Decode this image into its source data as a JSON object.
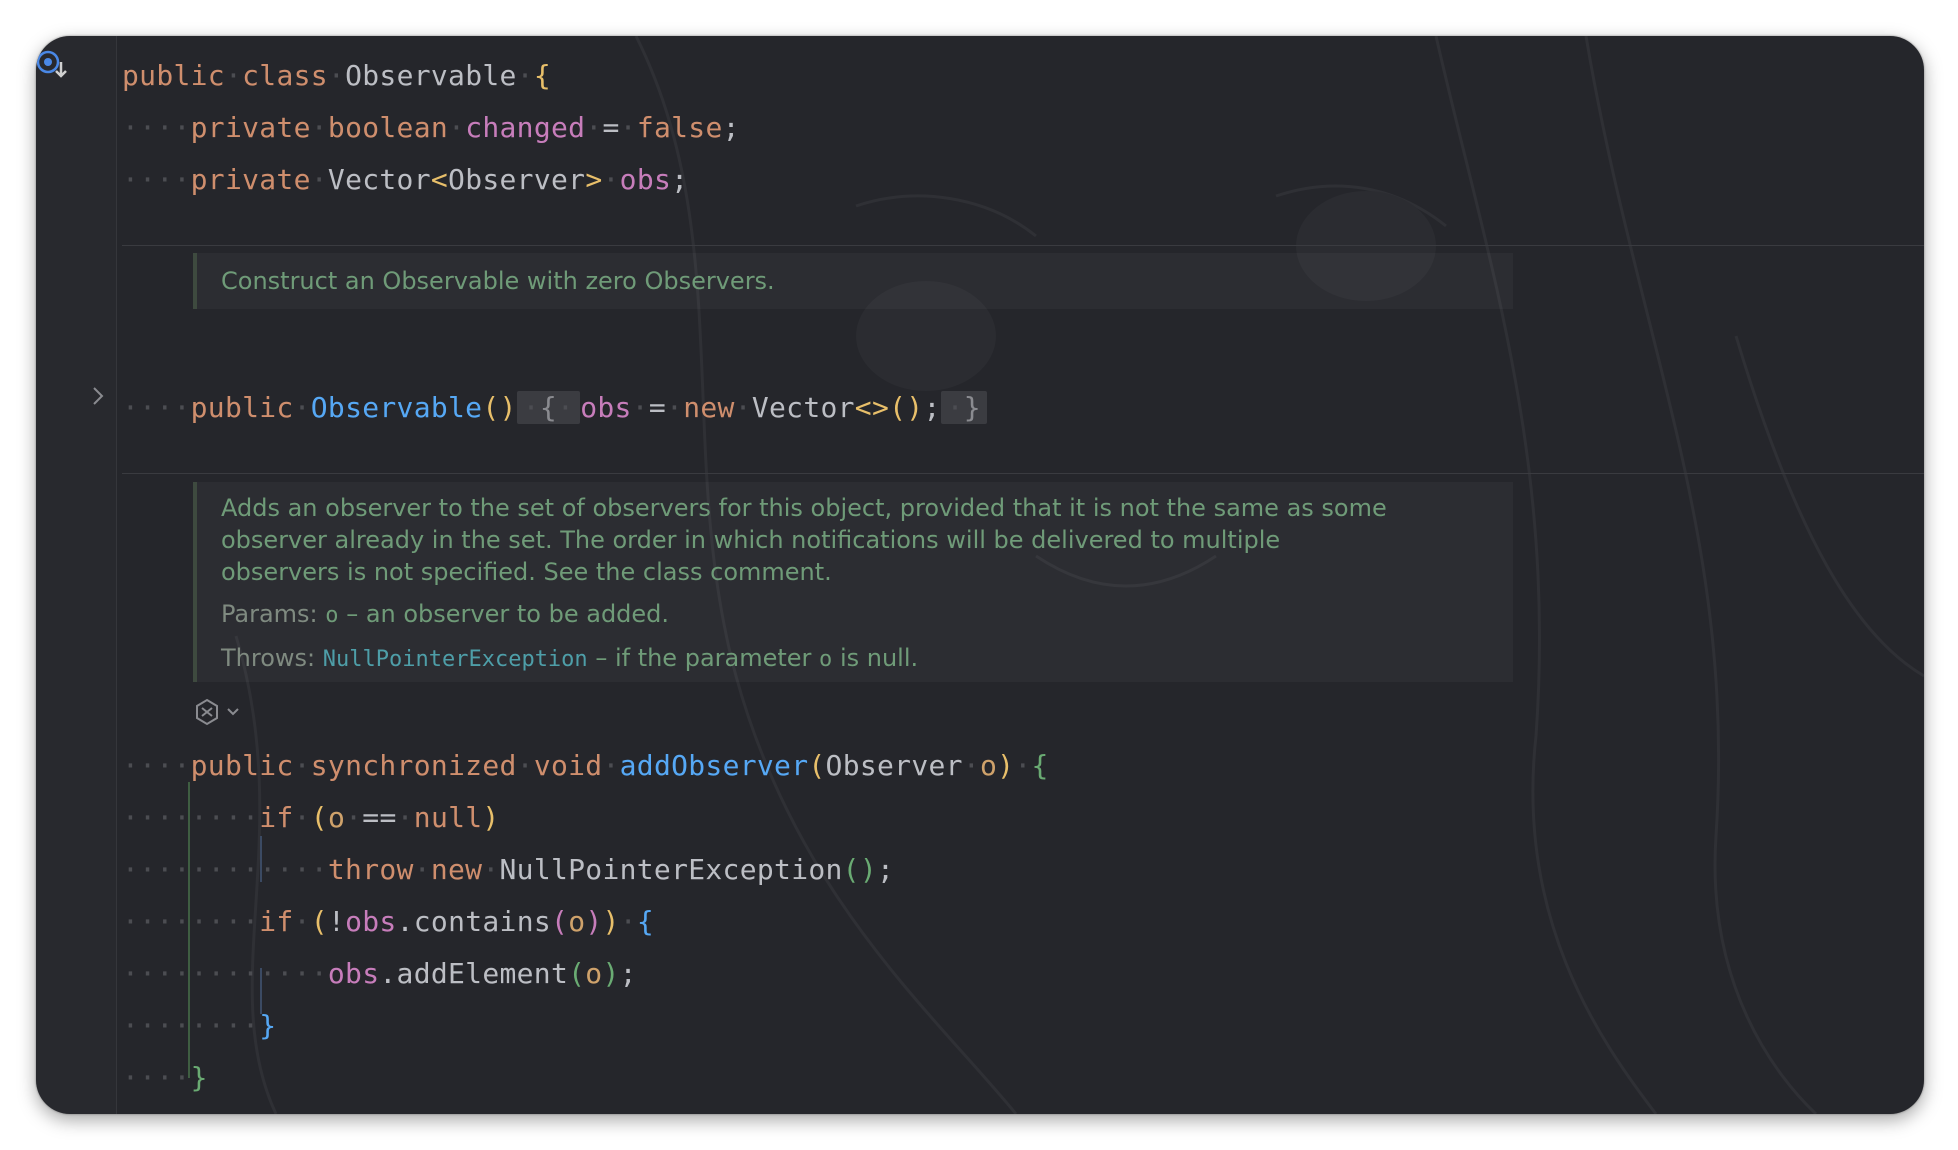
{
  "colors": {
    "background": "#25262b",
    "keyword": "#cf8e6d",
    "field": "#c77dbb",
    "function": "#56a8f5",
    "text": "#bcbec4",
    "doc_comment": "#6f9b78",
    "doc_link": "#4e9ea8"
  },
  "icons": {
    "gutter": "implemented-by-icon",
    "fold": "chevron-right-icon",
    "ai": "ai-assistant-icon",
    "chevron": "chevron-down-icon"
  },
  "code": {
    "line1": {
      "kw1": "public",
      "kw2": "class",
      "name": "Observable",
      "brace": "{"
    },
    "line2": {
      "kw1": "private",
      "kw2": "boolean",
      "field": "changed",
      "eq": "=",
      "value": "false",
      "semi": ";"
    },
    "line3": {
      "kw1": "private",
      "type": "Vector",
      "lt": "<",
      "typearg": "Observer",
      "gt": ">",
      "field": "obs",
      "semi": ";"
    },
    "ctor": {
      "kw1": "public",
      "name": "Observable",
      "parens": "()",
      "open": "{",
      "field": "obs",
      "eq": "=",
      "kw_new": "new",
      "type": "Vector",
      "diamond": "<>",
      "call": "()",
      "semi": ";",
      "close": "}"
    },
    "method": {
      "kw1": "public",
      "kw2": "synchronized",
      "kw3": "void",
      "name": "addObserver",
      "lparen": "(",
      "ptype": "Observer",
      "pname": "o",
      "rparen": ")",
      "brace": "{"
    },
    "if1": {
      "kw": "if",
      "lparen": "(",
      "var": "o",
      "op": "==",
      "kw_null": "null",
      "rparen": ")"
    },
    "throw": {
      "kw": "throw",
      "kw_new": "new",
      "type": "NullPointerException",
      "call": "()",
      "semi": ";"
    },
    "if2": {
      "kw": "if",
      "lparen": "(",
      "not": "!",
      "field": "obs",
      "dot": ".",
      "method": "contains",
      "lp": "(",
      "arg": "o",
      "rp": ")",
      "rparen": ")",
      "brace": "{"
    },
    "add": {
      "field": "obs",
      "dot": ".",
      "method": "addElement",
      "lp": "(",
      "arg": "o",
      "rp": ")",
      "semi": ";"
    },
    "close_if": "}",
    "close_method": "}"
  },
  "docs": {
    "ctor": "Construct an Observable with zero Observers.",
    "add_lines": [
      "Adds an observer to the set of observers for this object, provided that it is not the same as some",
      "observer already in the set. The order in which notifications will be delivered to multiple",
      "observers is not specified. See the class comment."
    ],
    "params_label": "Params:",
    "params_name": "o",
    "params_text": "– an observer to be added.",
    "throws_label": "Throws:",
    "throws_type": "NullPointerException",
    "throws_text_a": "– if the parameter",
    "throws_param": "o",
    "throws_text_b": "is null."
  }
}
